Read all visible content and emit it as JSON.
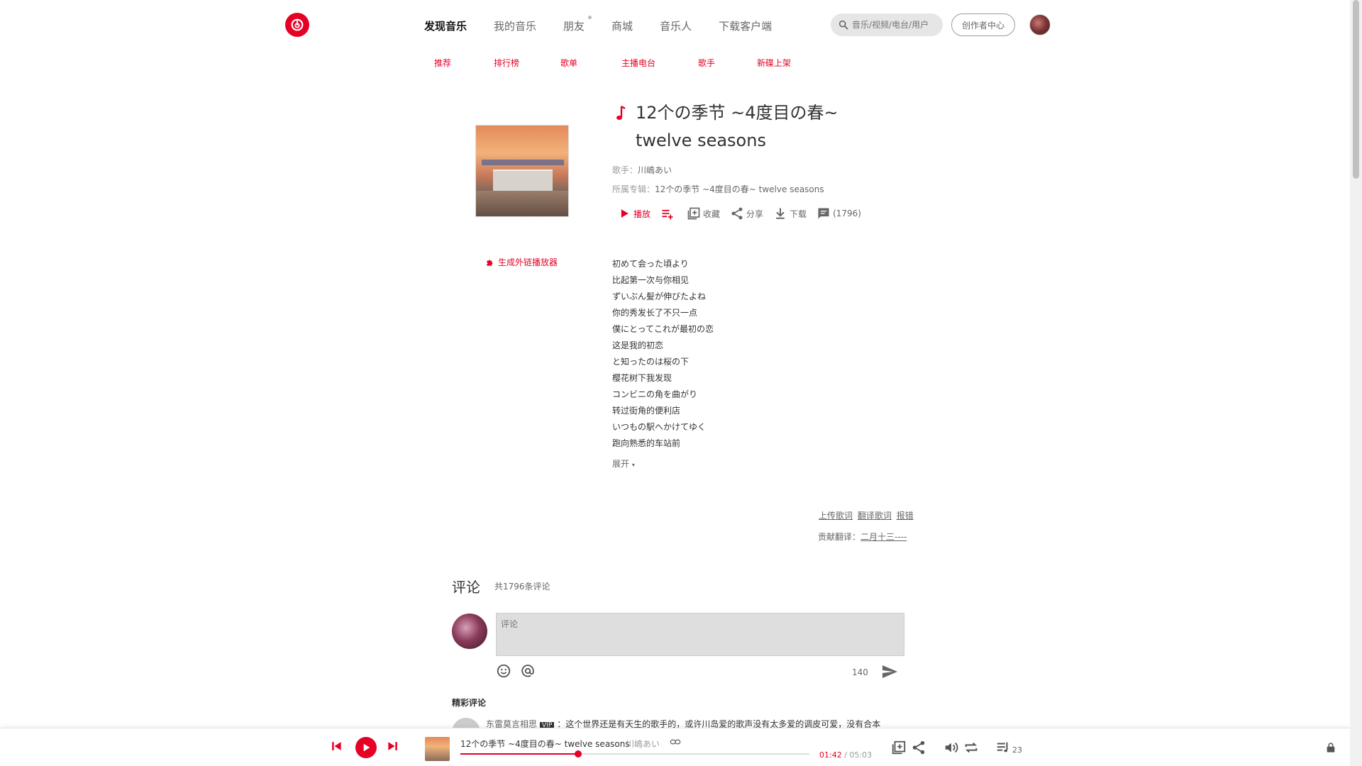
{
  "nav": {
    "items": [
      "发现音乐",
      "我的音乐",
      "朋友",
      "商城",
      "音乐人",
      "下载客户端"
    ],
    "search_placeholder": "音乐/视频/电台/用户",
    "creator_label": "创作者中心"
  },
  "subnav": [
    "推荐",
    "排行榜",
    "歌单",
    "主播电台",
    "歌手",
    "新碟上架"
  ],
  "song": {
    "title": "12个の季节 ~4度目の春~ twelve seasons",
    "artist_label": "歌手：",
    "artist": "川嶋あい",
    "album_label": "所属专辑：",
    "album": "12个の季节 ~4度目の春~ twelve seasons",
    "actions": {
      "play": "播放",
      "collect": "收藏",
      "share": "分享",
      "download": "下载",
      "comments": "(1796)"
    },
    "embed_label": "生成外链播放器"
  },
  "lyrics": [
    "初めて会った頃より",
    "比起第一次与你相见",
    "ずいぶん髪が伸びたよね",
    "你的秀发长了不只一点",
    "僕にとってこれが最初の恋",
    "这是我的初恋",
    "と知ったのは桜の下",
    "樱花树下我发现",
    "コンビニの角を曲がり",
    "转过街角的便利店",
    "いつもの駅へかけてゆく",
    "跑向熟悉的车站前"
  ],
  "expand_label": "展开",
  "lyric_links": {
    "upload": "上传歌词",
    "translate": "翻译歌词",
    "report": "报错",
    "contrib_label": "贡献翻译：",
    "contributor": "二月十三----"
  },
  "comments": {
    "title": "评论",
    "count": "共1796条评论",
    "placeholder": "评论",
    "limit": "140",
    "hot_title": "精彩评论",
    "hot_first": {
      "user": "东雷莫言相思",
      "badge": "VIP",
      "text": "：这个世界还是有天生的歌手的，或许川岛爱的歌声没有太多爱的调皮可爱，没有合本"
    }
  },
  "player": {
    "title": "12个の季节 ~4度目の春~ twelve seasons",
    "artist": "川嶋あい",
    "current": "01:42",
    "total": " / 05:03",
    "progress": 0.3366,
    "playlist_count": "23"
  },
  "colors": {
    "accent": "#e60026",
    "text": "#333333",
    "muted": "#999999"
  }
}
